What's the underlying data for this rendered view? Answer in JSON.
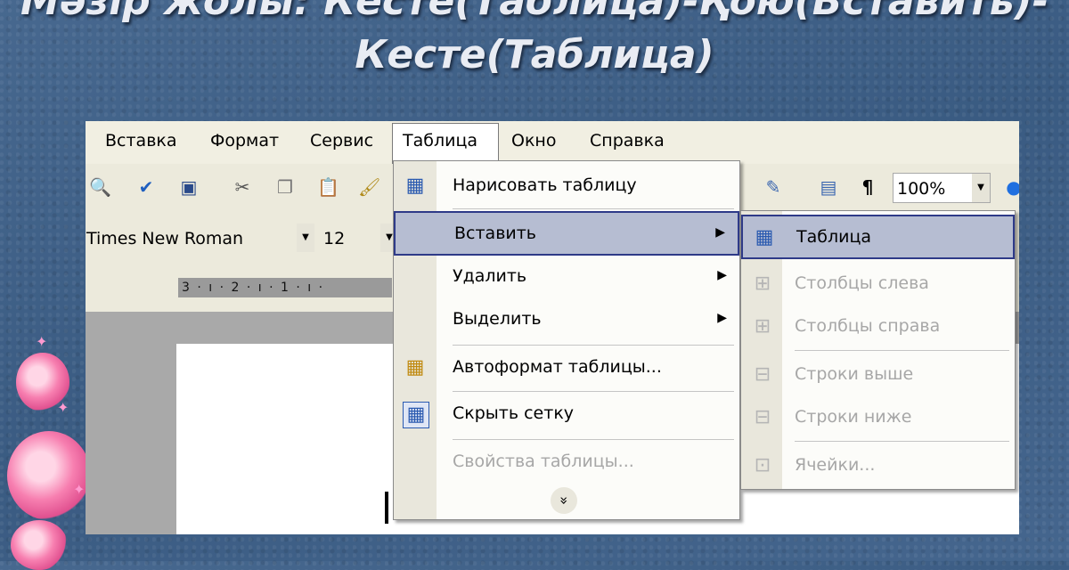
{
  "slide": {
    "title_line1": "Мәзір жолы: Кесте(Таблица)-Қою(Вставить)-",
    "title_line2": "Кесте(Таблица)"
  },
  "menubar": {
    "items": [
      "Вставка",
      "Формат",
      "Сервис",
      "Таблица",
      "Окно",
      "Справка"
    ],
    "active": "Таблица"
  },
  "toolbar": {
    "font_name": "Times New Roman",
    "font_size": "12",
    "zoom": "100%",
    "paragraph_mark": "¶",
    "icons": [
      "print-preview-icon",
      "spelling-icon",
      "research-icon",
      "cut-icon",
      "copy-icon",
      "paste-icon",
      "format-painter-icon",
      "drawing-icon",
      "document-map-icon",
      "show-hide-icon",
      "help-icon"
    ]
  },
  "ruler": {
    "labels": "3 · ı · 2 · ı · 1 · ı ·"
  },
  "table_menu": {
    "items": [
      {
        "label": "Нарисовать таблицу",
        "icon": "draw-table-icon"
      },
      {
        "label": "Вставить",
        "submenu": true,
        "highlighted": true
      },
      {
        "label": "Удалить",
        "submenu": true
      },
      {
        "label": "Выделить",
        "submenu": true
      },
      {
        "label": "Автоформат таблицы...",
        "icon": "autoformat-table-icon"
      },
      {
        "label": "Скрыть сетку",
        "icon": "hide-gridlines-icon"
      },
      {
        "label": "Свойства таблицы...",
        "disabled": true
      }
    ],
    "expand": "»"
  },
  "insert_submenu": {
    "items": [
      {
        "label": "Таблица",
        "icon": "insert-table-icon",
        "highlighted": true
      },
      {
        "label": "Столбцы слева",
        "icon": "columns-left-icon",
        "disabled": true
      },
      {
        "label": "Столбцы справа",
        "icon": "columns-right-icon",
        "disabled": true
      },
      {
        "label": "Строки выше",
        "icon": "rows-above-icon",
        "disabled": true
      },
      {
        "label": "Строки ниже",
        "icon": "rows-below-icon",
        "disabled": true
      },
      {
        "label": "Ячейки...",
        "icon": "cells-icon",
        "disabled": true
      }
    ]
  },
  "colors": {
    "background": "#3e5f86",
    "highlight": "#b6bdd2",
    "highlight_border": "#2e3a88",
    "disabled_text": "#a7a7a7"
  }
}
